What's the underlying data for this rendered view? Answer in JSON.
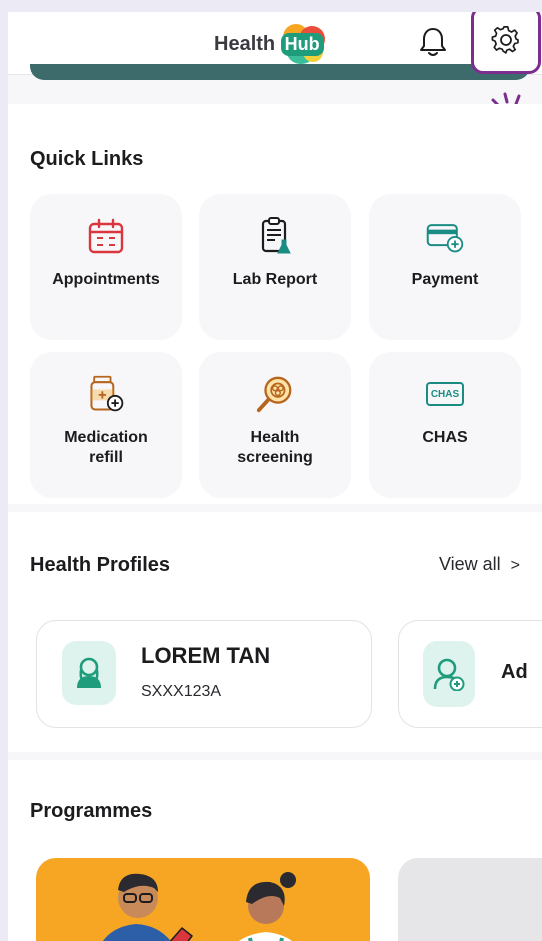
{
  "header": {
    "logo_text": "Health",
    "logo_hub": "Hub"
  },
  "quick_links": {
    "title": "Quick Links",
    "items": [
      {
        "label": "Appointments",
        "icon": "calendar-icon"
      },
      {
        "label": "Lab Report",
        "icon": "lab-report-icon"
      },
      {
        "label": "Payment",
        "icon": "payment-card-icon"
      },
      {
        "label": "Medication\nrefill",
        "label_line1": "Medication",
        "label_line2": "refill",
        "icon": "medication-bottle-icon"
      },
      {
        "label_line1": "Health",
        "label_line2": "screening",
        "icon": "screening-magnifier-icon"
      },
      {
        "label": "CHAS",
        "icon": "chas-badge-icon",
        "badge_text": "CHAS"
      }
    ]
  },
  "health_profiles": {
    "title": "Health Profiles",
    "view_all": "View all",
    "view_all_chevron": ">",
    "profile": {
      "name": "LOREM TAN",
      "id": "SXXX123A"
    },
    "add_card_label": "Ad"
  },
  "programmes": {
    "title": "Programmes"
  },
  "colors": {
    "accent_green": "#1f9c7c",
    "icon_red": "#d9363e",
    "icon_teal": "#1b8c84",
    "highlight_purple": "#7a2f8e",
    "banner": "#3d6b6b",
    "programme_orange": "#f6a623"
  }
}
